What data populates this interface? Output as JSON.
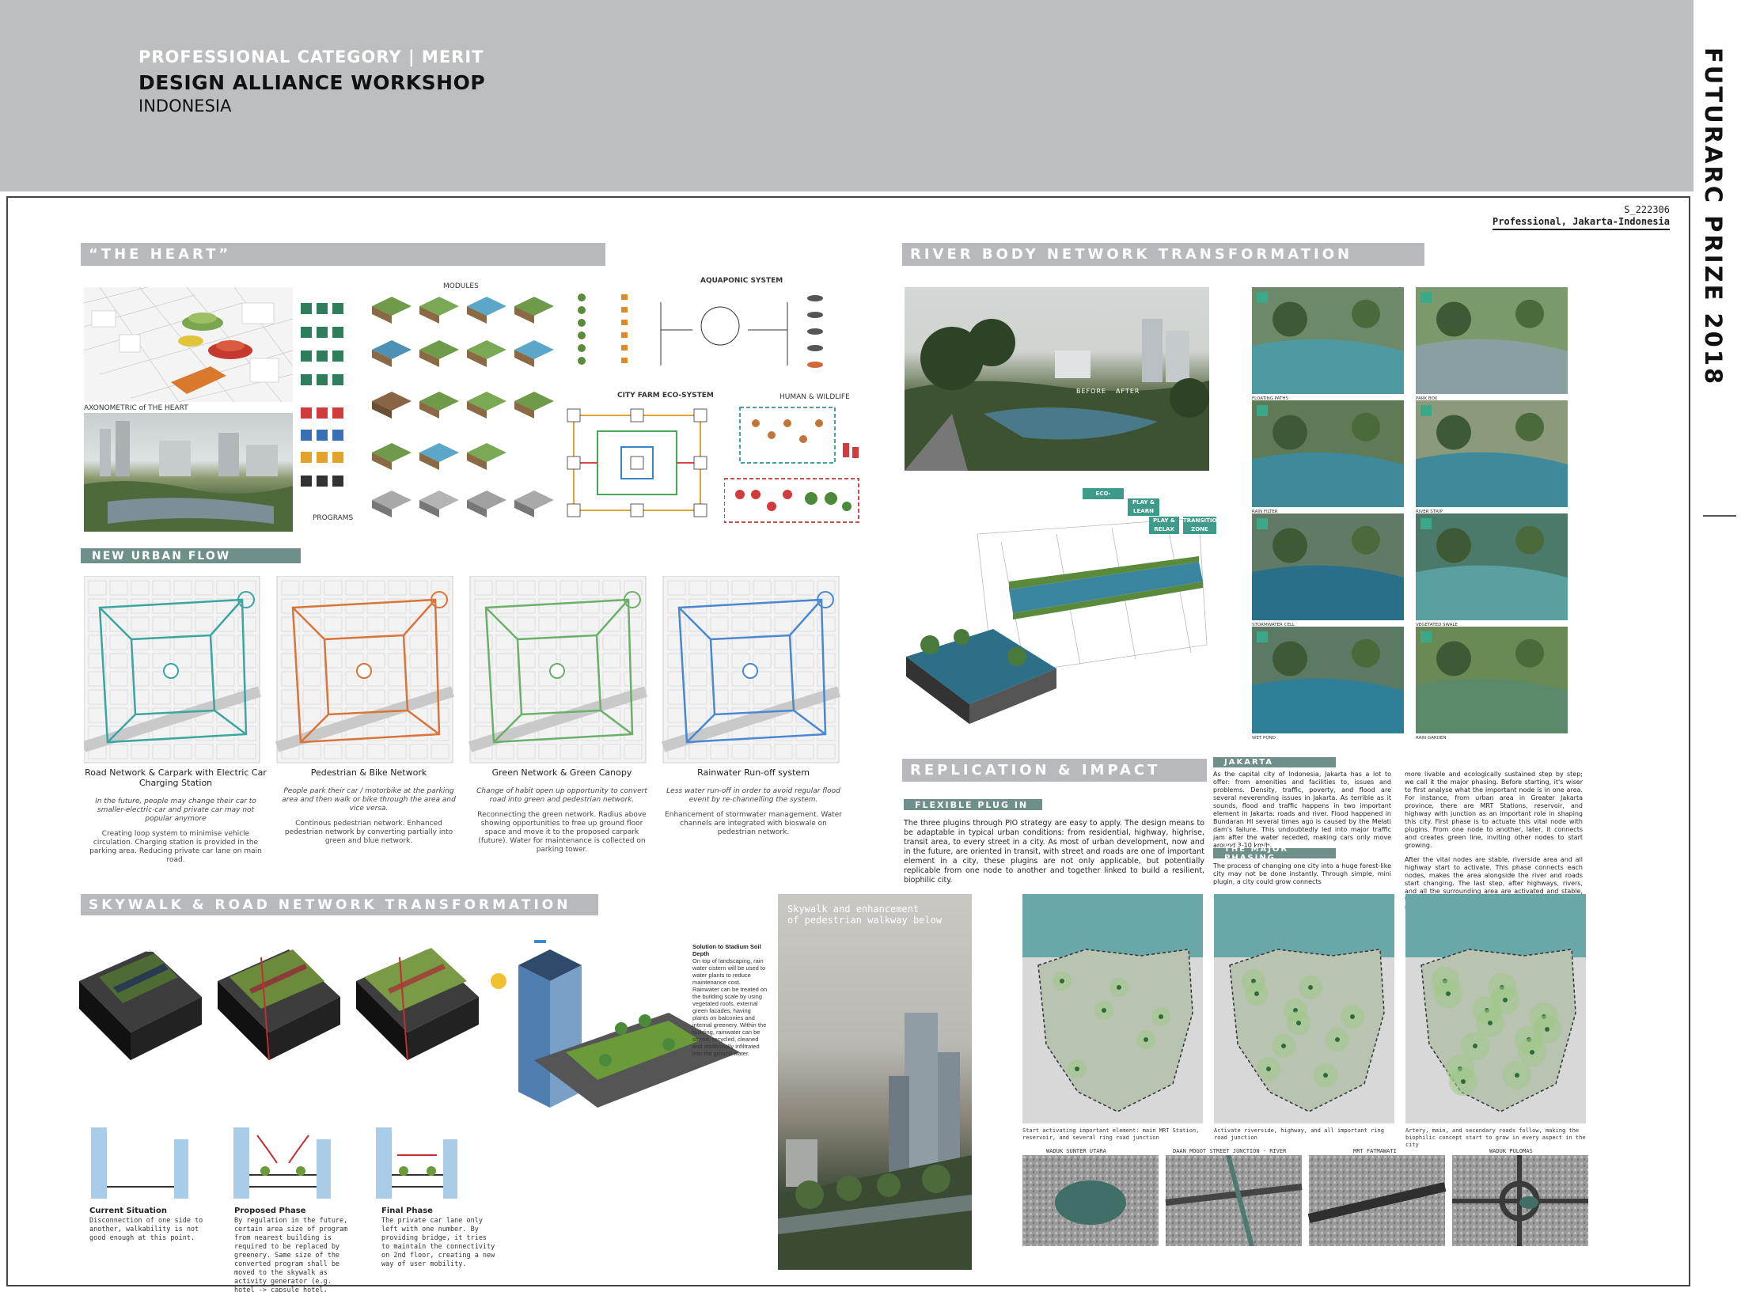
{
  "header": {
    "category": "PROFESSIONAL CATEGORY",
    "separator": "|",
    "award": "MERIT",
    "firm": "DESIGN ALLIANCE WORKSHOP",
    "country": "INDONESIA"
  },
  "side_title": "FUTURARC PRIZE 2018",
  "submission": {
    "id": "S_222306",
    "category_line": "Professional, Jakarta-Indonesia"
  },
  "heart": {
    "title": "“THE HEART”",
    "axo_caption": "AXONOMETRIC of THE HEART",
    "modules_label": "MODULES",
    "programs_label": "PROGRAMS",
    "aquaponic_label": "AQUAPONIC SYSTEM",
    "cityfarm_label": "CITY FARM ECO-SYSTEM",
    "wildlife_label": "HUMAN & WILDLIFE"
  },
  "urban_flow": {
    "title": "NEW URBAN FLOW",
    "columns": [
      {
        "title": "Road Network & Carpark with Electric Car Charging Station",
        "italic": "In the future, people may change their car to smaller-electric-car and private car may not popular anymore",
        "body": "Creating loop system to minimise vehicle circulation. Charging station is provided in the parking area. Reducing private car lane on main road.",
        "color": "#3aa6a0"
      },
      {
        "title": "Pedestrian & Bike Network",
        "italic": "People park their car / motorbike at the parking area and then walk or bike through the area and vice versa.",
        "body": "Continous pedestrian network. Enhanced pedestrian network by converting partially into green and blue network.",
        "color": "#d9743a"
      },
      {
        "title": "Green Network & Green Canopy",
        "italic": "Change of habit open up opportunity to convert road into green and pedestrian network.",
        "body": "Reconnecting the green network. Radius above showing opportunities to free up ground floor space and move it to the proposed carpark (future). Water for maintenance is collected on parking tower.",
        "color": "#6ab06a"
      },
      {
        "title": "Rainwater Run-off system",
        "italic": "Less water run-off in order to avoid regular flood event by re-channelling the system.",
        "body": "Enhancement of stormwater management. Water channels are integrated with bioswale on pedestrian network.",
        "color": "#4a88d0"
      }
    ]
  },
  "skywalk": {
    "title": "SKYWALK & ROAD NETWORK TRANSFORMATION",
    "phases": [
      {
        "title": "Current Situation",
        "text": "Disconnection of one side to another, walkability is not good enough at this point."
      },
      {
        "title": "Proposed Phase",
        "text": "By regulation in the future, certain area size of program from nearest building is required to be replaced by greenery. Same size of the converted program shall be moved to the skywalk as activity generator (e.g. hotel -> capsule hotel, office -> coworking space, etc)"
      },
      {
        "title": "Final Phase",
        "text": "The private car lane only left with one number. By providing bridge, it tries to maintain the connectivity on 2nd floor, creating a new way of user mobility."
      }
    ],
    "note_title": "Solution to Stadium Soil Depth",
    "note_text": "On top of landscaping, rain water cistern will be used to water plants to reduce maintenance cost. Rainwater can be treated on the building scale by using vegetated roofs, external green facades, having plants on balconies and internal greenery. Within the building, rainwater can be stored, recycled, cleaned and additionally infiltrated into the ground water.",
    "render_caption_1": "Skywalk and enhancement",
    "render_caption_2": "of pedestrian walkway  below"
  },
  "river": {
    "title": "RIVER BODY NETWORK TRANSFORMATION",
    "before": "BEFORE",
    "after": "AFTER",
    "callouts": [
      "ECO-SERVICE",
      "PLAY & LEARN",
      "PLAY & RELAX",
      "TRANSITION ZONE"
    ],
    "photo_captions": [
      "FLOATING PATHS",
      "PARK BOX",
      "RAIN FILTER",
      "RIVER STRIP",
      "STORMWATER CELL",
      "VEGETATED SWALE",
      "WET POND",
      "RAIN GARDEN"
    ]
  },
  "replication": {
    "title": "REPLICATION & IMPACT",
    "plug_title": "FLEXIBLE PLUG IN",
    "plug_text": "The three plugins through PIO strategy are easy to apply. The design means to be adaptable in typical urban conditions: from residential, highway, highrise, transit area, to every street in a city. As most of urban development, now and in the future, are oriented in transit, with street and roads are one of important element in a city, these plugins are not only applicable, but potentially replicable from one node to another and together linked to build a resilient, biophilic city.",
    "jakarta_title": "JAKARTA",
    "jakarta_text": "As the capital city of Indonesia, Jakarta has a lot to offer: from amenities and facilities to, issues and problems. Density, traffic, poverty, and flood are several neverending issues in Jakarta. As terrible as it sounds, flood and traffic happens in two important element in Jakarta: roads and river. Flood happened in Bundaran HI several times ago is caused by the Melati dam's failure. This undoubtedly led into major traffic jam after the water receded, making cars only move around 3-10 km/h.",
    "phasing_title": "THE MAJOR PHASING",
    "phasing_text": "The process of changing one city into a huge forest-like city may not be done instantly. Through simple, mini plugin, a city could grow connects",
    "right_text_1": "more livable and ecologically sustained step by step; we call it the major phasing. Before starting, it's wiser to first analyse what the important node is in one area. For instance, from urban area in Greater Jakarta province, there are MRT Stations, reservoir, and highway with junction as an important role in shaping this city. First phase is to actuate this vital node with plugins. From one node to another, later, it connects and creates green line, inviting other nodes to start growing.",
    "right_text_2": "After the vital nodes are stable, riverside area and all highway start to activate. This phase connects each nodes, makes the area alongside the river and roads start changing. The last step, after highways, rivers, and all the surrounding area are activated and stable, the green path start to grow inside the urban function: residential, office, commercial area, etc.",
    "map_captions": [
      "Start activating important element: main MRT Station, reservoir, and several ring road junction",
      "Activate riverside, highway, and all important ring road junction",
      "Artery, main, and secondary roads follow, making the biophilic concept start to grow in every aspect in the city"
    ],
    "aerial_labels": [
      "WADUK SUNTER UTARA",
      "DAAN MOGOT STREET JUNCTION - RIVER",
      "MRT FATMAWATI",
      "WADUK PULOMAS"
    ]
  }
}
